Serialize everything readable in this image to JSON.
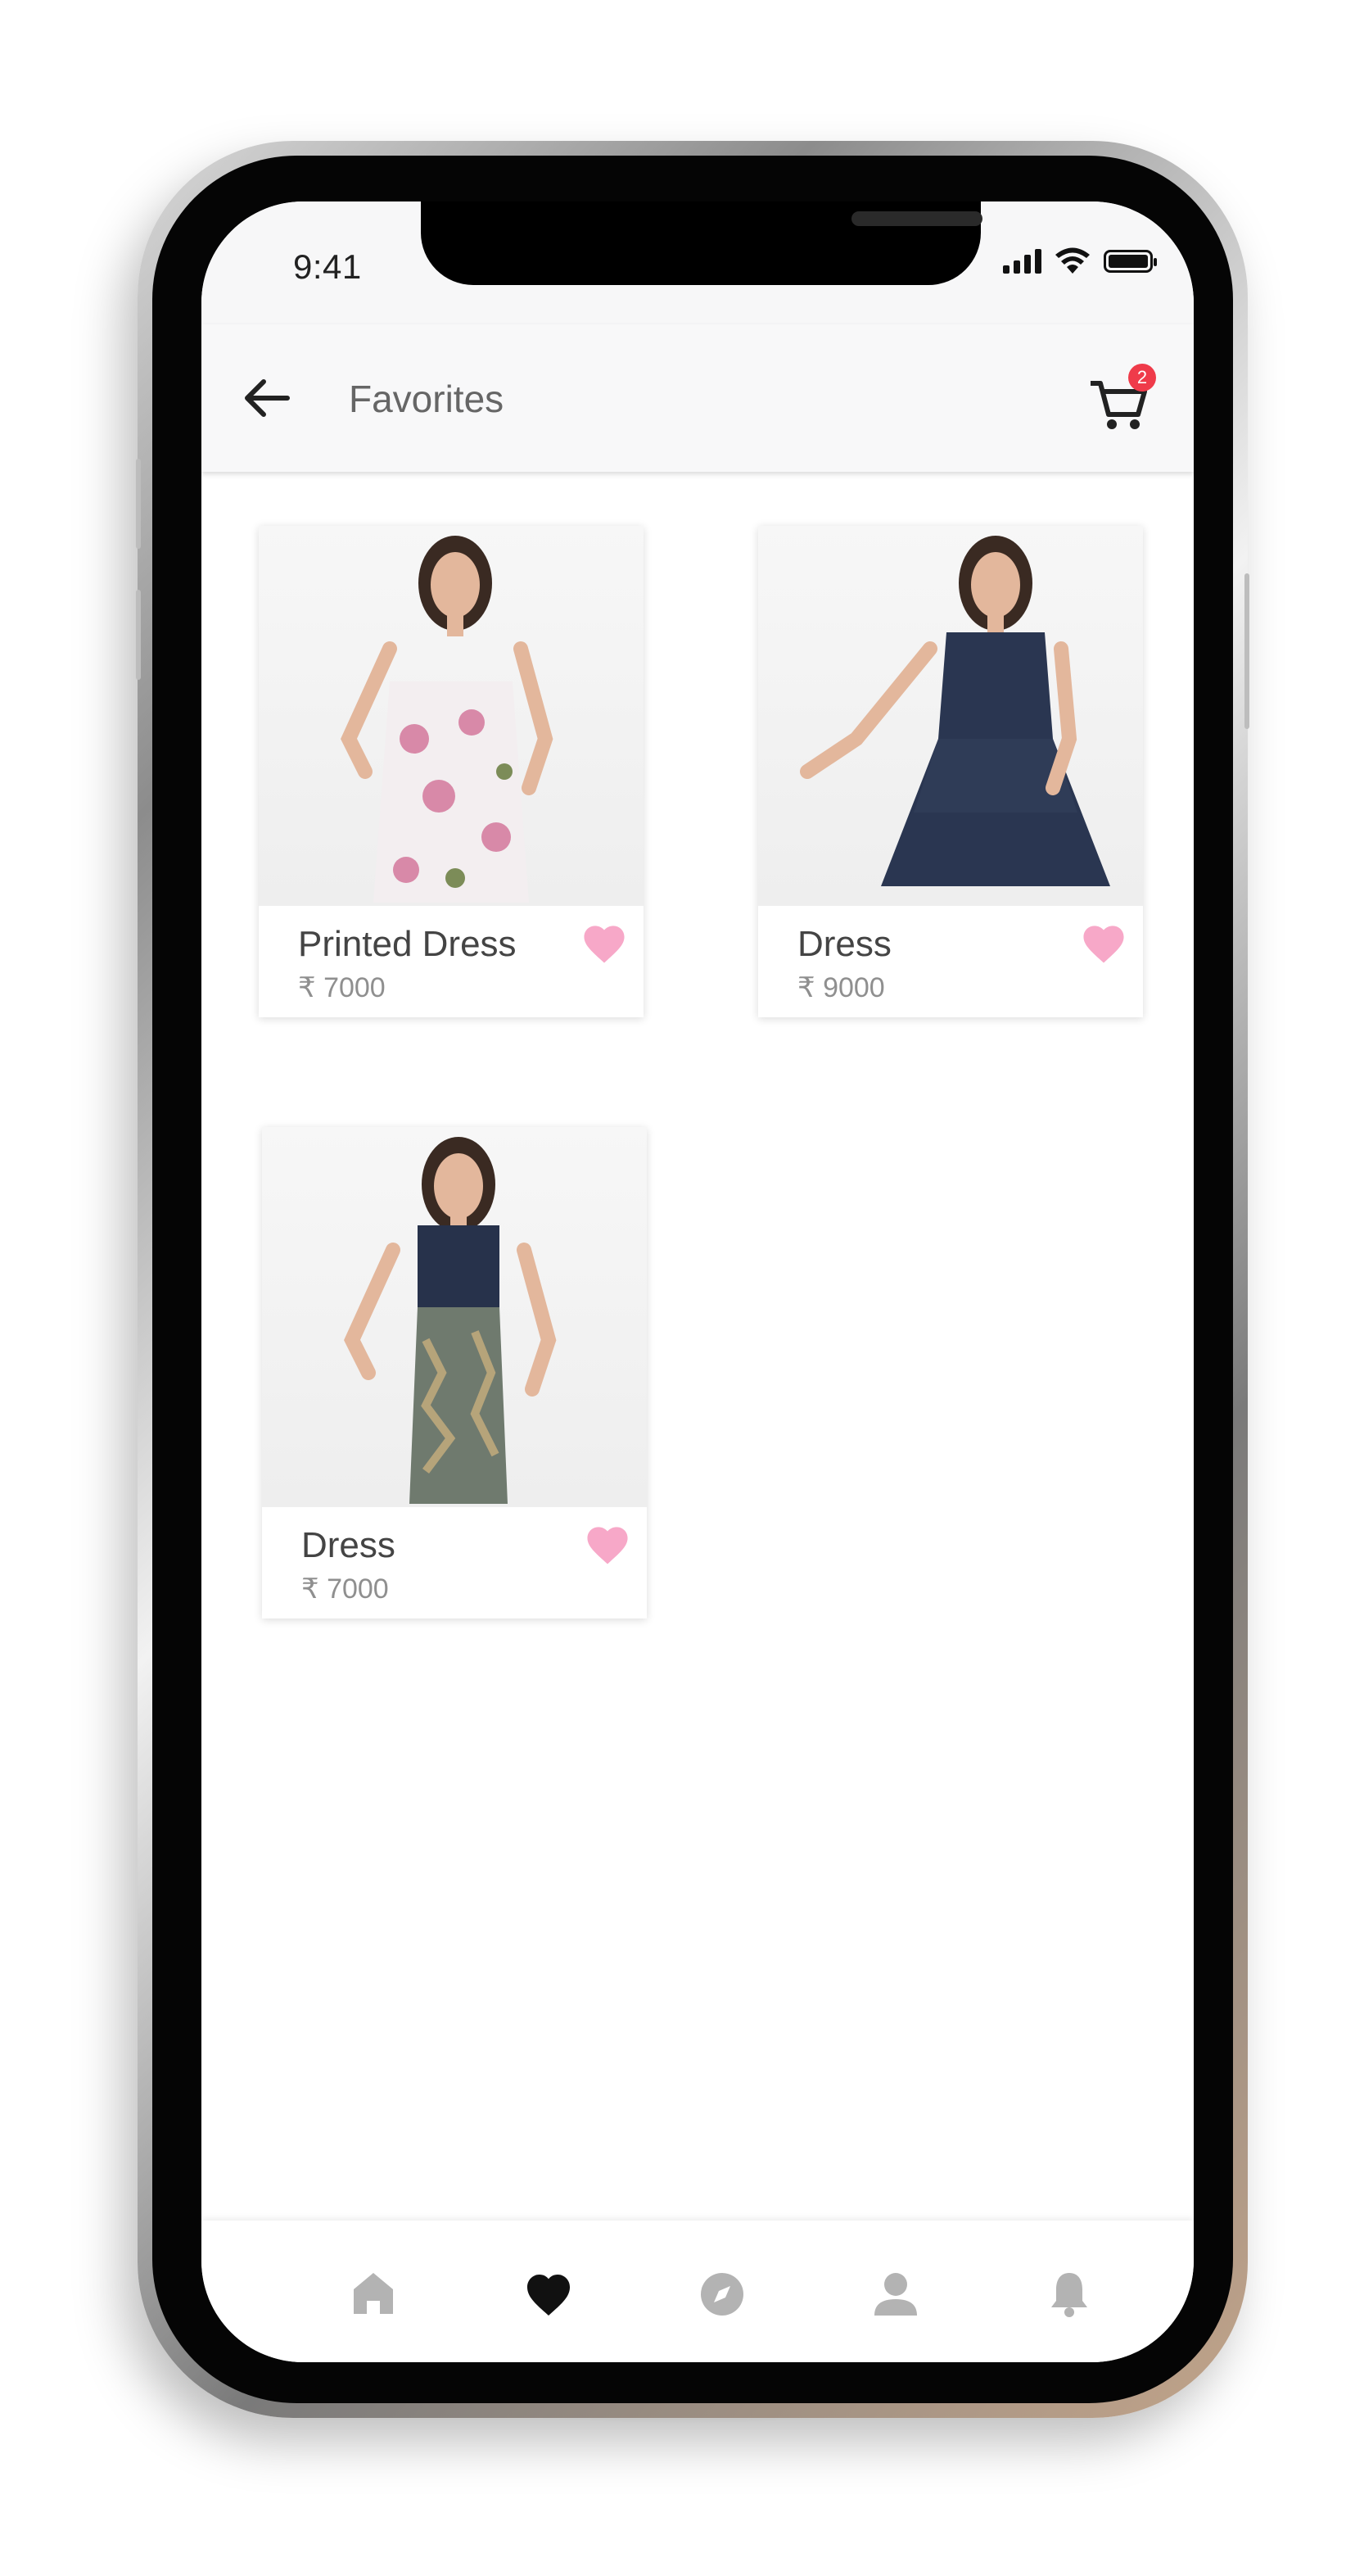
{
  "status_bar": {
    "time": "9:41",
    "icons": [
      "signal-icon",
      "wifi-icon",
      "battery-icon"
    ]
  },
  "app_bar": {
    "title": "Favorites",
    "back_icon": "arrow-left-icon",
    "cart_icon": "shopping-cart-icon",
    "cart_count": "2"
  },
  "favorites": [
    {
      "title": "Printed Dress",
      "price": "₹ 7000",
      "dress_colors": [
        "#f3eef0",
        "#d889a8",
        "#7c8c58"
      ],
      "favorite": true
    },
    {
      "title": "Dress",
      "price": "₹ 9000",
      "dress_colors": [
        "#2a3651",
        "#34415e"
      ],
      "favorite": true
    },
    {
      "title": "Dress",
      "price": "₹ 7000",
      "dress_colors": [
        "#27324b",
        "#6f7a6e",
        "#b6a47a"
      ],
      "favorite": true
    }
  ],
  "bottom_nav": {
    "items": [
      {
        "icon": "home-icon",
        "active": false
      },
      {
        "icon": "heart-icon",
        "active": true
      },
      {
        "icon": "compass-icon",
        "active": false
      },
      {
        "icon": "user-icon",
        "active": false
      },
      {
        "icon": "bell-icon",
        "active": false
      }
    ]
  },
  "colors": {
    "accent_heart": "#f7a8c8",
    "badge": "#ef3b4a",
    "nav_active": "#111111",
    "nav_inactive": "#b3b3b3"
  }
}
